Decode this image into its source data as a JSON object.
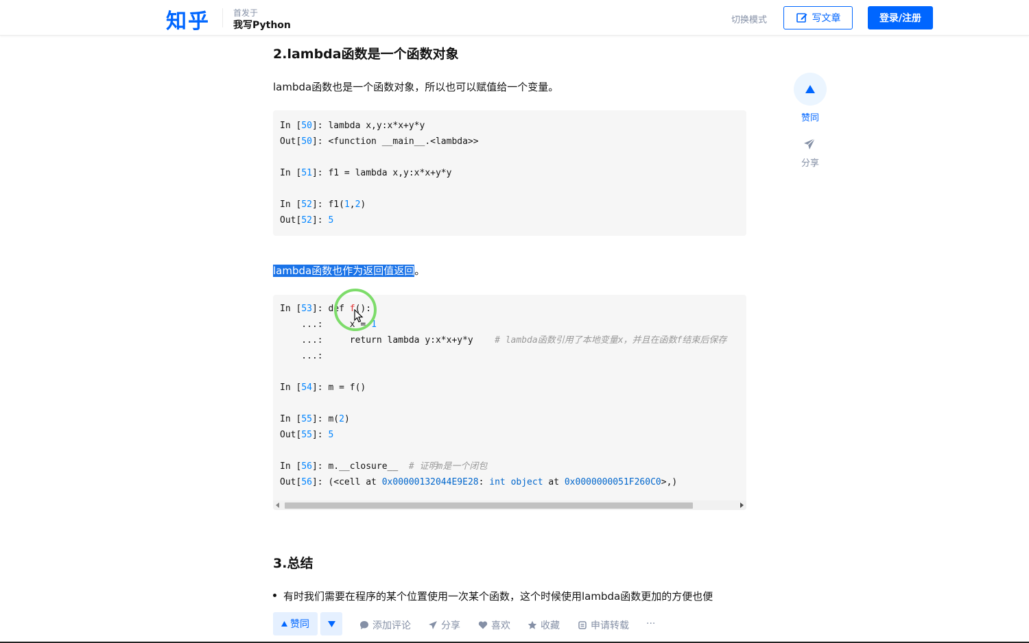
{
  "header": {
    "logo": "知乎",
    "publish_label": "首发于",
    "publication_name": "我写Python",
    "mode_toggle": "切换模式",
    "write_button": "写文章",
    "login_button": "登录/注册"
  },
  "article": {
    "section2_title": "2.lambda函数是一个函数对象",
    "section2_para": "lambda函数也是一个函数对象，所以也可以赋值给一个变量。",
    "return_para_highlight": "lambda函数也作为返回值返回",
    "return_para_tail": "。",
    "section3_title": "3.总结",
    "bullet1": "有时我们需要在程序的某个位置使用一次某个函数，这个时候使用lambda函数更加的方便也便"
  },
  "code1": {
    "l1_prompt": "In [",
    "l1_num": "50",
    "l1_rest": "]: lambda x,y:x*x+y*y",
    "l2_prompt": "Out[",
    "l2_num": "50",
    "l2_rest": "]: <function __main__.<lambda>>",
    "l4_prompt": "In [",
    "l4_num": "51",
    "l4_rest": "]: f1 = lambda x,y:x*x+y*y",
    "l6_prompt": "In [",
    "l6_num": "52",
    "l6_mid": "]: f1(",
    "l6_a": "1",
    "l6_comma": ",",
    "l6_b": "2",
    "l6_close": ")",
    "l7_prompt": "Out[",
    "l7_num": "52",
    "l7_mid": "]: ",
    "l7_val": "5"
  },
  "code2": {
    "l1_prompt": "In [",
    "l1_num": "53",
    "l1_mid": "]: def ",
    "l1_fn": "f",
    "l1_tail": "():",
    "l2_prefix": "    ...:     x = ",
    "l2_val": "1",
    "l3_prefix": "    ...:     return lambda y:x*x+y*y    ",
    "l3_comment": "# lambda函数引用了本地变量x，并且在函数f结束后保存",
    "l4": "    ...:",
    "l6_prompt": "In [",
    "l6_num": "54",
    "l6_rest": "]: m = f()",
    "l8_prompt": "In [",
    "l8_num": "55",
    "l8_mid": "]: m(",
    "l8_arg": "2",
    "l8_close": ")",
    "l9_prompt": "Out[",
    "l9_num": "55",
    "l9_mid": "]: ",
    "l9_val": "5",
    "l11_prompt": "In [",
    "l11_num": "56",
    "l11_mid": "]: m.__closure__  ",
    "l11_comment": "# 证明m是一个闭包",
    "l12_prompt": "Out[",
    "l12_num": "56",
    "l12_mid": "]: (<cell at ",
    "l12_hex1": "0x00000132044E9E28",
    "l12_mid2": ": ",
    "l12_int": "int object",
    "l12_mid3": " at ",
    "l12_hex2": "0x0000000051F260C0",
    "l12_tail": ">,)"
  },
  "side": {
    "vote_label": "赞同",
    "share_label": "分享"
  },
  "bottom": {
    "agree": "赞同",
    "comment": "添加评论",
    "share": "分享",
    "like": "喜欢",
    "favorite": "收藏",
    "repost": "申请转载",
    "more": "···"
  },
  "colors": {
    "brand": "#0066ff",
    "highlight": "#1a73e8",
    "cursor_ring": "#7ddc6a"
  }
}
